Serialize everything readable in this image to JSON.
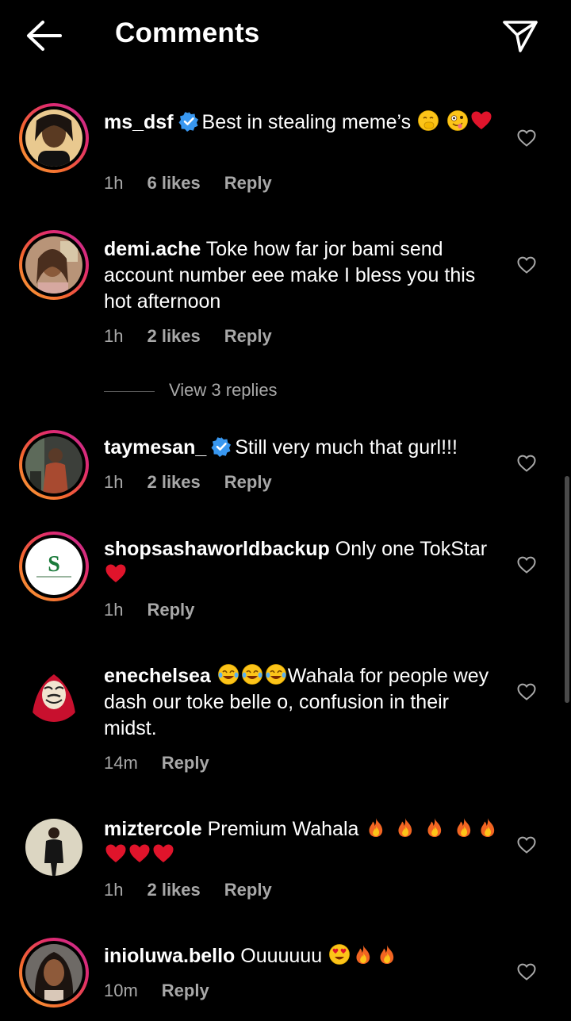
{
  "header": {
    "title": "Comments"
  },
  "comments": [
    {
      "username": "ms_dsf",
      "verified": true,
      "text_a": "Best in stealing meme’s",
      "text_b": "",
      "time": "1h",
      "likes": "6 likes",
      "reply": "Reply"
    },
    {
      "username": "demi.ache",
      "verified": false,
      "text_a": "Toke how far jor bami send account number eee make I bless you this hot afternoon",
      "text_b": "",
      "time": "1h",
      "likes": "2 likes",
      "reply": "Reply"
    },
    {
      "username": "taymesan_",
      "verified": true,
      "text_a": "Still very much that gurl!!!",
      "text_b": "",
      "time": "1h",
      "likes": "2 likes",
      "reply": "Reply"
    },
    {
      "username": "shopsashaworldbackup",
      "verified": false,
      "text_a": "Only one TokStar",
      "text_b": "",
      "time": "1h",
      "likes": "",
      "reply": "Reply"
    },
    {
      "username": "enechelsea",
      "verified": false,
      "text_a": "",
      "text_b": "Wahala for people wey dash our toke belle o, confusion in their midst.",
      "time": "14m",
      "likes": "",
      "reply": "Reply"
    },
    {
      "username": "miztercole",
      "verified": false,
      "text_a": "Premium Wahala",
      "text_b": "",
      "time": "1h",
      "likes": "2 likes",
      "reply": "Reply"
    },
    {
      "username": "inioluwa.bello",
      "verified": false,
      "text_a": "Ouuuuuu",
      "text_b": "",
      "time": "10m",
      "likes": "",
      "reply": "Reply"
    }
  ],
  "view_replies": "View 3 replies",
  "icons": {
    "back": "arrow-left-icon",
    "send": "paper-plane-icon",
    "like": "heart-outline-icon",
    "verified": "verified-badge-icon"
  },
  "colors": {
    "background": "#000000",
    "meta": "#a8a8a8",
    "verified": "#3897f0",
    "story_ring": "#e02a6e"
  }
}
